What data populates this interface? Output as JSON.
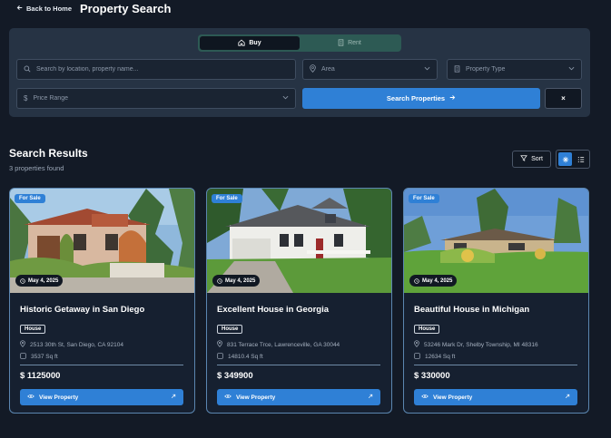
{
  "header": {
    "back_label": "Back to Home",
    "title": "Property Search"
  },
  "search": {
    "tabs": [
      {
        "label": "Buy",
        "icon": "home-icon",
        "active": true
      },
      {
        "label": "Rent",
        "icon": "building-icon",
        "active": false
      }
    ],
    "location_placeholder": "Search by location, property name...",
    "area_placeholder": "Area",
    "property_type_placeholder": "Property Type",
    "price_range_placeholder": "Price Range",
    "search_button_label": "Search Properties",
    "clear_button_label": "×"
  },
  "results": {
    "title": "Search Results",
    "count_text": "3 properties found",
    "sort_label": "Sort",
    "view_modes": [
      {
        "name": "grid",
        "active": true
      },
      {
        "name": "list",
        "active": false
      }
    ]
  },
  "properties": [
    {
      "status": "For Sale",
      "date": "May 4, 2025",
      "title": "Historic Getaway in San Diego",
      "type": "House",
      "address": "2513 30th St, San Diego, CA 92104",
      "sqft": "3537 Sq ft",
      "price": "$ 1125000",
      "cta": "View Property"
    },
    {
      "status": "For Sale",
      "date": "May 4, 2025",
      "title": "Excellent House in Georgia",
      "type": "House",
      "address": "831 Terrace Trce, Lawrenceville, GA 30044",
      "sqft": "14810.4 Sq ft",
      "price": "$ 349900",
      "cta": "View Property"
    },
    {
      "status": "For Sale",
      "date": "May 4, 2025",
      "title": "Beautiful House in Michigan",
      "type": "House",
      "address": "53246 Mark Dr, Shelby Township, MI 48316",
      "sqft": "12634 Sq ft",
      "price": "$ 330000",
      "cta": "View Property"
    }
  ],
  "colors": {
    "background": "#131a26",
    "panel": "#263344",
    "accent": "#2f80d6",
    "rent_tab": "#2d5a54",
    "card_border": "#5b86b0"
  }
}
